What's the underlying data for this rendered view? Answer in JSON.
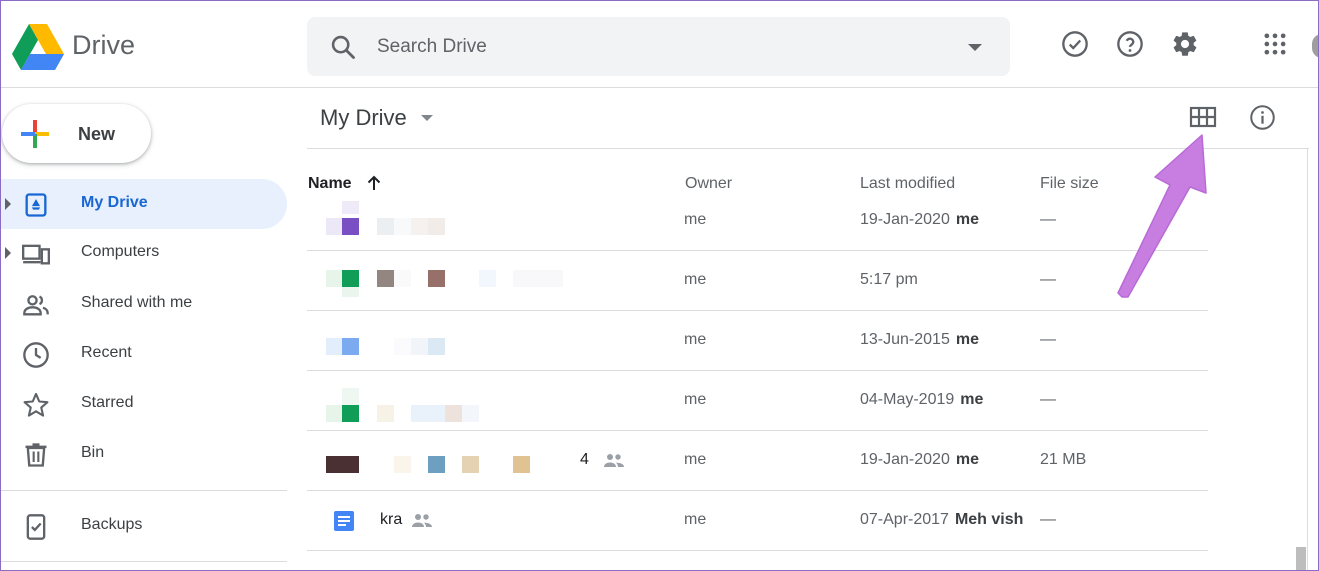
{
  "header": {
    "app_title": "Drive",
    "search_placeholder": "Search Drive"
  },
  "sidebar": {
    "new_label": "New",
    "items": [
      {
        "label": "My Drive",
        "active": true,
        "icon": "my-drive-icon"
      },
      {
        "label": "Computers",
        "active": false,
        "icon": "computers-icon"
      },
      {
        "label": "Shared with me",
        "active": false,
        "icon": "shared-icon"
      },
      {
        "label": "Recent",
        "active": false,
        "icon": "clock-icon"
      },
      {
        "label": "Starred",
        "active": false,
        "icon": "star-icon"
      },
      {
        "label": "Bin",
        "active": false,
        "icon": "trash-icon"
      },
      {
        "label": "Backups",
        "active": false,
        "icon": "backups-icon"
      }
    ]
  },
  "main": {
    "breadcrumb": "My Drive",
    "columns": {
      "name": "Name",
      "owner": "Owner",
      "modified": "Last modified",
      "size": "File size"
    },
    "rows": [
      {
        "name": "",
        "owner": "me",
        "modified": "19-Jan-2020",
        "modifier": "me",
        "size": "—"
      },
      {
        "name": "",
        "owner": "me",
        "modified": "5:17 pm",
        "modifier": "",
        "size": "—"
      },
      {
        "name": "",
        "owner": "me",
        "modified": "13-Jun-2015",
        "modifier": "me",
        "size": "—"
      },
      {
        "name": "",
        "owner": "me",
        "modified": "04-May-2019",
        "modifier": "me",
        "size": "—"
      },
      {
        "name": "4",
        "owner": "me",
        "modified": "19-Jan-2020",
        "modifier": "me",
        "size": "21 MB"
      },
      {
        "name": "kra",
        "owner": "me",
        "modified": "07-Apr-2017",
        "modifier": "Meh vish",
        "size": "—"
      }
    ]
  },
  "colors": {
    "accent": "#1967d2",
    "active_bg": "#e8f0fe",
    "annotation_arrow": "#c77ee0"
  }
}
